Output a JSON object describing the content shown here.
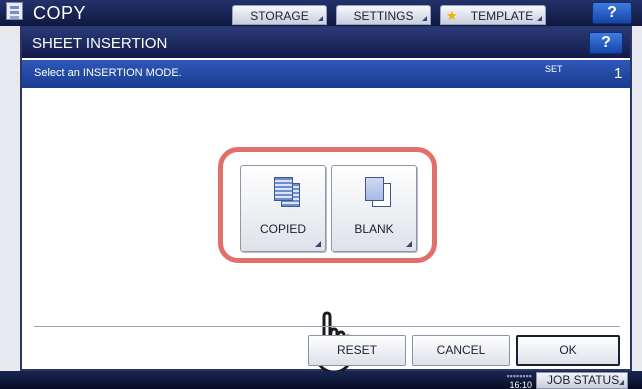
{
  "app": {
    "title": "COPY",
    "icon": "copy-app-icon",
    "tabs": [
      {
        "label": "STORAGE"
      },
      {
        "label": "SETTINGS"
      },
      {
        "label": "TEMPLATE",
        "icon": "star-icon"
      }
    ],
    "help_label": "?"
  },
  "dialog": {
    "title": "SHEET INSERTION",
    "help_label": "?",
    "message": "Select an INSERTION MODE.",
    "set_label": "SET",
    "set_value": "1",
    "modes": [
      {
        "label": "COPIED",
        "icon": "copied-sheet-icon"
      },
      {
        "label": "BLANK",
        "icon": "blank-sheet-icon"
      }
    ],
    "buttons": {
      "reset": "RESET",
      "cancel": "CANCEL",
      "ok": "OK"
    }
  },
  "status_bar": {
    "time": "16:10",
    "job_status": "JOB STATUS"
  },
  "colors": {
    "highlight": "#e2706a",
    "header_dark": "#111b47",
    "message_bar": "#2f57b8"
  }
}
